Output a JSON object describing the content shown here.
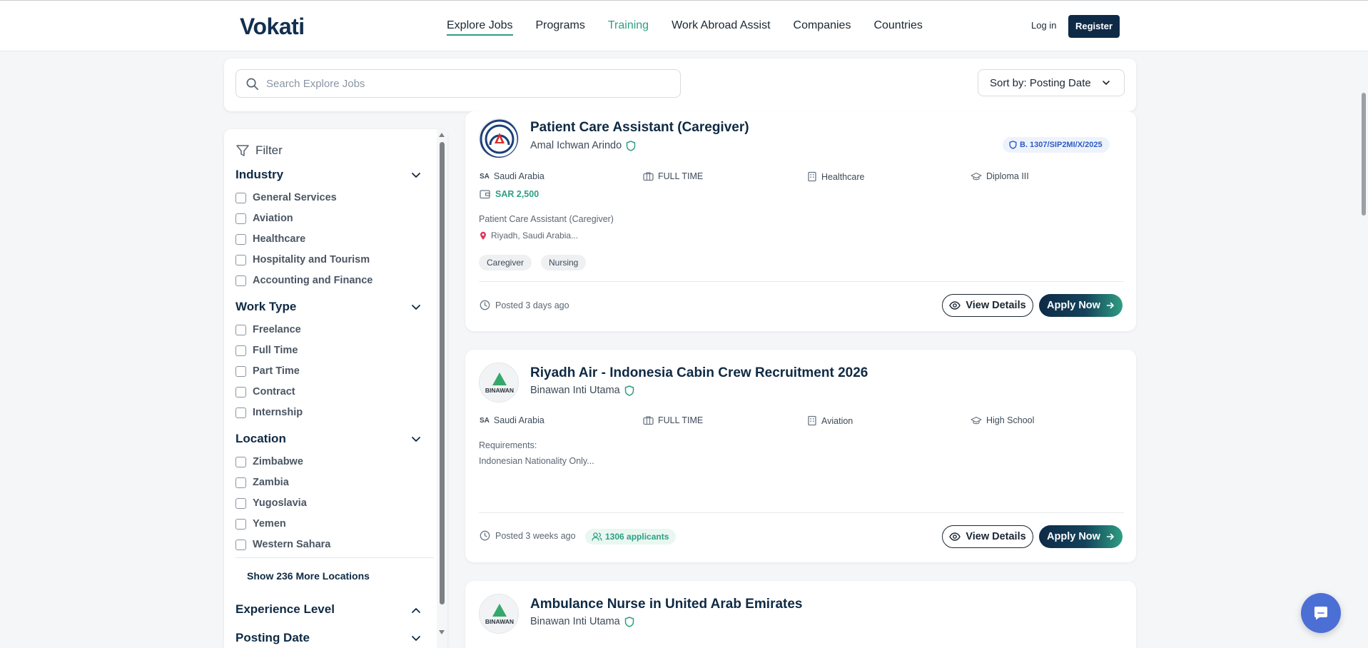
{
  "brand": {
    "logo_text": "Vokati"
  },
  "nav": {
    "items": [
      {
        "label": "Explore Jobs"
      },
      {
        "label": "Programs"
      },
      {
        "label": "Training"
      },
      {
        "label": "Work Abroad Assist"
      },
      {
        "label": "Companies"
      },
      {
        "label": "Countries"
      }
    ],
    "login_label": "Log in",
    "register_label": "Register"
  },
  "search": {
    "placeholder": "Search Explore Jobs",
    "sort_label": "Sort by: Posting Date"
  },
  "filters": {
    "title": "Filter",
    "industry": {
      "title": "Industry",
      "options": [
        "General Services",
        "Aviation",
        "Healthcare",
        "Hospitality and Tourism",
        "Accounting and Finance"
      ]
    },
    "work_type": {
      "title": "Work Type",
      "options": [
        "Freelance",
        "Full Time",
        "Part Time",
        "Contract",
        "Internship"
      ]
    },
    "location": {
      "title": "Location",
      "options": [
        "Zimbabwe",
        "Zambia",
        "Yugoslavia",
        "Yemen",
        "Western Sahara"
      ],
      "show_more": "Show 236 More Locations"
    },
    "experience": {
      "title": "Experience Level"
    },
    "posting_date": {
      "title": "Posting Date"
    }
  },
  "jobs": [
    {
      "title": "Patient Care Assistant (Caregiver)",
      "company": "Amal Ichwan Arindo",
      "license": "B. 1307/SIP2MI/X/2025",
      "country_code": "SA",
      "country": "Saudi Arabia",
      "work_type": "FULL TIME",
      "industry": "Healthcare",
      "education": "Diploma III",
      "salary": "SAR 2,500",
      "description": "Patient Care Assistant (Caregiver)",
      "location": "Riyadh, Saudi Arabia...",
      "tags": [
        "Caregiver",
        "Nursing"
      ],
      "posted": "Posted 3 days ago",
      "view_label": "View Details",
      "apply_label": "Apply Now"
    },
    {
      "title": "Riyadh Air - Indonesia Cabin Crew Recruitment 2026",
      "company": "Binawan Inti Utama",
      "country_code": "SA",
      "country": "Saudi Arabia",
      "work_type": "FULL TIME",
      "industry": "Aviation",
      "education": "High School",
      "desc_line1": "Requirements:",
      "desc_line2": "Indonesian Nationality Only...",
      "posted": "Posted 3 weeks ago",
      "applicants": "1306 applicants",
      "view_label": "View Details",
      "apply_label": "Apply Now"
    },
    {
      "title": "Ambulance Nurse in United Arab Emirates",
      "company": "Binawan Inti Utama"
    }
  ],
  "company_logos": {
    "binawan_text": "BINAWAN"
  },
  "colors": {
    "navy": "#0e2a47",
    "accent_green": "#2e9e83",
    "license_blue": "#2c5cc5",
    "chat_blue": "#4c6fd6"
  }
}
